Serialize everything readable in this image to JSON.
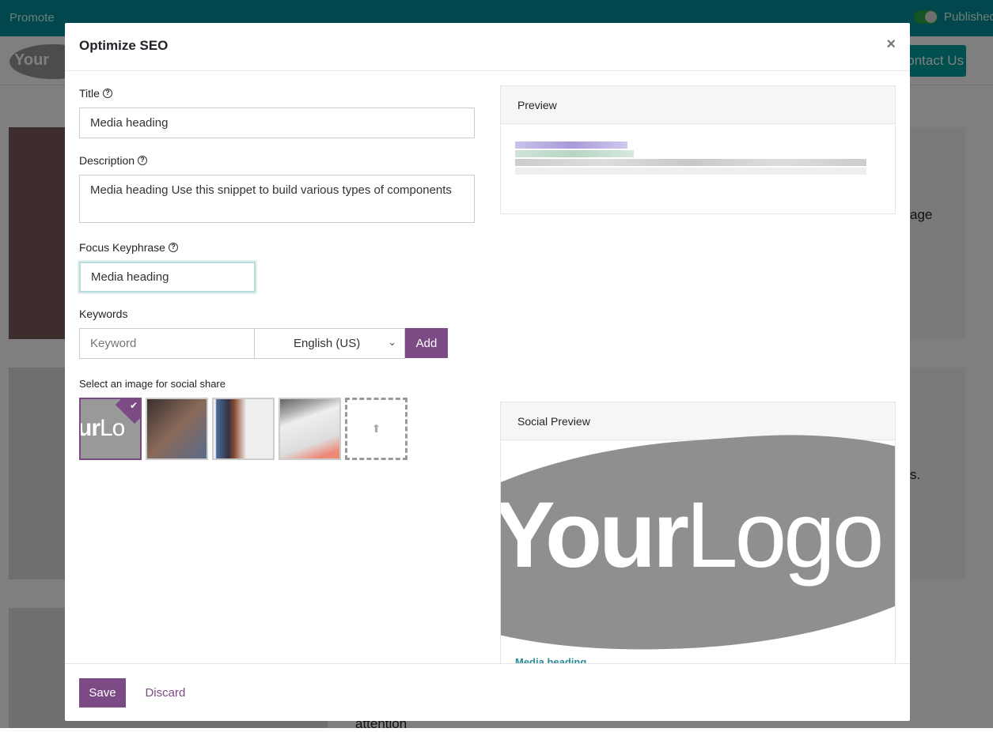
{
  "background": {
    "topbar": {
      "promote": "Promote",
      "published": "Published"
    },
    "logo": "YourLogo",
    "contact": "Contact Us",
    "texts": [
      "age",
      "s.",
      "attention"
    ]
  },
  "modal": {
    "title": "Optimize SEO",
    "close_icon": "×",
    "title_label": "Title",
    "title_value": "Media heading",
    "description_label": "Description",
    "description_value": "Media heading Use this snippet to build various types of components",
    "focus_label": "Focus Keyphrase",
    "focus_value": "Media heading",
    "keywords_label": "Keywords",
    "keyword_placeholder": "Keyword",
    "language": "English (US)",
    "add": "Add",
    "social_label": "Select an image for social share",
    "preview_title": "Preview",
    "social_preview_title": "Social Preview",
    "social_logo": "YourLogo",
    "social_heading": "Media heading",
    "save": "Save",
    "discard": "Discard"
  },
  "colors": {
    "primary": "#7c4a84",
    "teal": "#02a0a0"
  }
}
